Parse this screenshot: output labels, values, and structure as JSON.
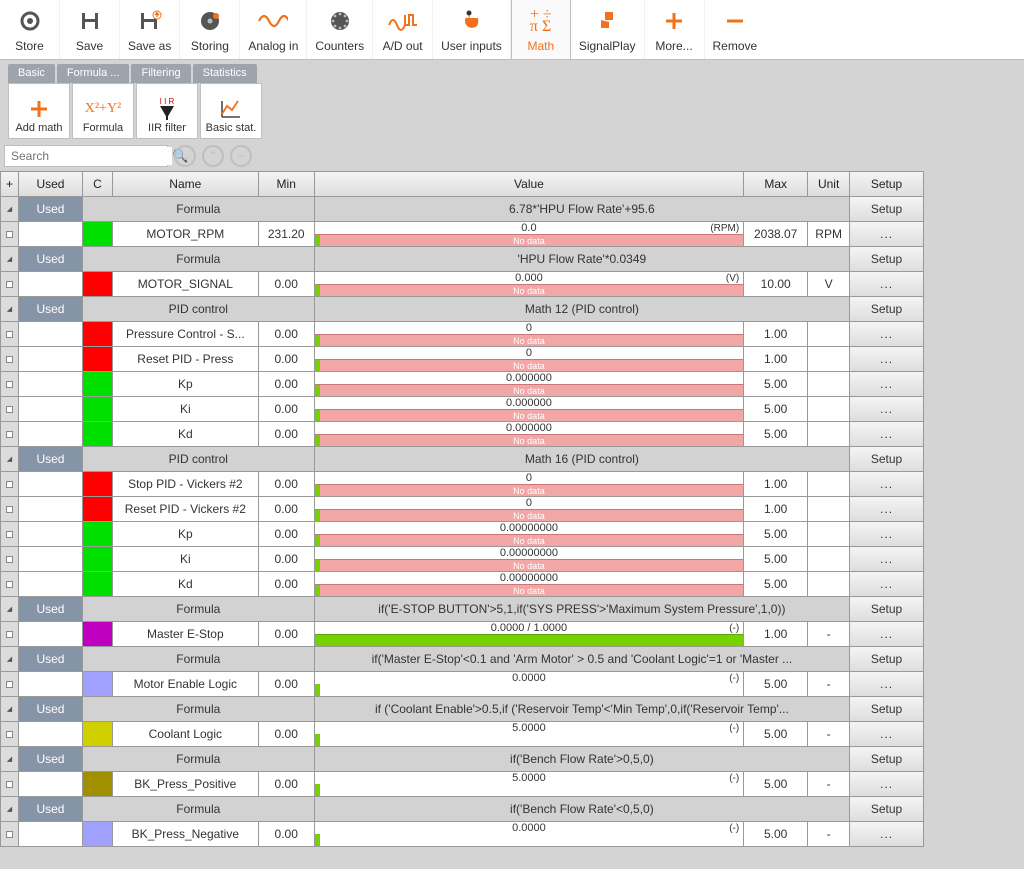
{
  "ribbon": [
    {
      "id": "store",
      "label": "Store",
      "accent": false
    },
    {
      "id": "save",
      "label": "Save",
      "accent": false
    },
    {
      "id": "saveas",
      "label": "Save as",
      "accent": false
    },
    {
      "id": "storing",
      "label": "Storing",
      "accent": false
    },
    {
      "id": "analogin",
      "label": "Analog in",
      "accent": true
    },
    {
      "id": "counters",
      "label": "Counters",
      "accent": false
    },
    {
      "id": "adout",
      "label": "A/D out",
      "accent": true
    },
    {
      "id": "userinputs",
      "label": "User inputs",
      "accent": false
    },
    {
      "id": "math",
      "label": "Math",
      "accent": true,
      "active": true
    },
    {
      "id": "signalplay",
      "label": "SignalPlay",
      "accent": true
    },
    {
      "id": "more",
      "label": "More...",
      "accent": true
    },
    {
      "id": "remove",
      "label": "Remove",
      "accent": true
    }
  ],
  "subtabs": [
    "Basic",
    "Formula ...",
    "Filtering",
    "Statistics"
  ],
  "subbtns": [
    {
      "id": "addmath",
      "label": "Add math"
    },
    {
      "id": "formula",
      "label": "Formula"
    },
    {
      "id": "iir",
      "label": "IIR filter"
    },
    {
      "id": "basicstat",
      "label": "Basic stat."
    }
  ],
  "search_placeholder": "Search",
  "headers": {
    "plus": "+",
    "used": "Used",
    "c": "C",
    "name": "Name",
    "min": "Min",
    "value": "Value",
    "max": "Max",
    "unit": "Unit",
    "setup": "Setup"
  },
  "setup_label": "Setup",
  "ellipsis": "...",
  "nodata": "No data",
  "groups": [
    {
      "used": "Used",
      "type": "Formula",
      "value": "6.78*'HPU Flow Rate'+95.6",
      "rows": [
        {
          "color": "#00e000",
          "name": "MOTOR_RPM",
          "min": "231.20",
          "val": "0.0",
          "rt": "(RPM)",
          "max": "2038.07",
          "unit": "RPM",
          "bar": "pink"
        }
      ]
    },
    {
      "used": "Used",
      "type": "Formula",
      "value": "'HPU Flow Rate'*0.0349",
      "rows": [
        {
          "color": "#ff0000",
          "name": "MOTOR_SIGNAL",
          "min": "0.00",
          "val": "0.000",
          "rt": "(V)",
          "max": "10.00",
          "unit": "V",
          "bar": "pink"
        }
      ]
    },
    {
      "used": "Used",
      "type": "PID control",
      "value": "Math 12 (PID control)",
      "rows": [
        {
          "color": "#ff0000",
          "name": "Pressure Control - S...",
          "min": "0.00",
          "val": "0",
          "rt": "",
          "max": "1.00",
          "unit": "",
          "bar": "pink"
        },
        {
          "color": "#ff0000",
          "name": "Reset PID - Press",
          "min": "0.00",
          "val": "0",
          "rt": "",
          "max": "1.00",
          "unit": "",
          "bar": "pink"
        },
        {
          "color": "#00e000",
          "name": "Kp",
          "min": "0.00",
          "val": "0.000000",
          "rt": "",
          "max": "5.00",
          "unit": "",
          "bar": "pink"
        },
        {
          "color": "#00e000",
          "name": "Ki",
          "min": "0.00",
          "val": "0.000000",
          "rt": "",
          "max": "5.00",
          "unit": "",
          "bar": "pink"
        },
        {
          "color": "#00e000",
          "name": "Kd",
          "min": "0.00",
          "val": "0.000000",
          "rt": "",
          "max": "5.00",
          "unit": "",
          "bar": "pink"
        }
      ]
    },
    {
      "used": "Used",
      "type": "PID control",
      "value": "Math 16 (PID control)",
      "rows": [
        {
          "color": "#ff0000",
          "name": "Stop PID - Vickers #2",
          "min": "0.00",
          "val": "0",
          "rt": "",
          "max": "1.00",
          "unit": "",
          "bar": "pink"
        },
        {
          "color": "#ff0000",
          "name": "Reset PID - Vickers #2",
          "min": "0.00",
          "val": "0",
          "rt": "",
          "max": "1.00",
          "unit": "",
          "bar": "pink"
        },
        {
          "color": "#00e000",
          "name": "Kp",
          "min": "0.00",
          "val": "0.00000000",
          "rt": "",
          "max": "5.00",
          "unit": "",
          "bar": "pink"
        },
        {
          "color": "#00e000",
          "name": "Ki",
          "min": "0.00",
          "val": "0.00000000",
          "rt": "",
          "max": "5.00",
          "unit": "",
          "bar": "pink"
        },
        {
          "color": "#00e000",
          "name": "Kd",
          "min": "0.00",
          "val": "0.00000000",
          "rt": "",
          "max": "5.00",
          "unit": "",
          "bar": "pink"
        }
      ]
    },
    {
      "used": "Used",
      "type": "Formula",
      "value": "if('E-STOP BUTTON'>5,1,if('SYS PRESS'>'Maximum System Pressure',1,0))",
      "rows": [
        {
          "color": "#c000c0",
          "name": "Master E-Stop",
          "min": "0.00",
          "val": "0.0000 / 1.0000",
          "rt": "(-)",
          "max": "1.00",
          "unit": "-",
          "bar": "green"
        }
      ]
    },
    {
      "used": "Used",
      "type": "Formula",
      "value": "if('Master E-Stop'<0.1 and 'Arm Motor' > 0.5 and 'Coolant Logic'=1 or 'Master ...",
      "rows": [
        {
          "color": "#a0a0ff",
          "name": "Motor Enable Logic",
          "min": "0.00",
          "val": "0.0000",
          "rt": "(-)",
          "max": "5.00",
          "unit": "-",
          "bar": "none"
        }
      ]
    },
    {
      "used": "Used",
      "type": "Formula",
      "value": "if ('Coolant Enable'>0.5,if ('Reservoir Temp'<'Min Temp',0,if('Reservoir Temp'...",
      "rows": [
        {
          "color": "#d0d000",
          "name": "Coolant Logic",
          "min": "0.00",
          "val": "5.0000",
          "rt": "(-)",
          "max": "5.00",
          "unit": "-",
          "bar": "none"
        }
      ]
    },
    {
      "used": "Used",
      "type": "Formula",
      "value": "if('Bench Flow Rate'>0,5,0)",
      "rows": [
        {
          "color": "#a09000",
          "name": "BK_Press_Positive",
          "min": "0.00",
          "val": "5.0000",
          "rt": "(-)",
          "max": "5.00",
          "unit": "-",
          "bar": "none"
        }
      ]
    },
    {
      "used": "Used",
      "type": "Formula",
      "value": "if('Bench Flow Rate'<0,5,0)",
      "rows": [
        {
          "color": "#a0a0ff",
          "name": "BK_Press_Negative",
          "min": "0.00",
          "val": "0.0000",
          "rt": "(-)",
          "max": "5.00",
          "unit": "-",
          "bar": "none"
        }
      ]
    }
  ]
}
